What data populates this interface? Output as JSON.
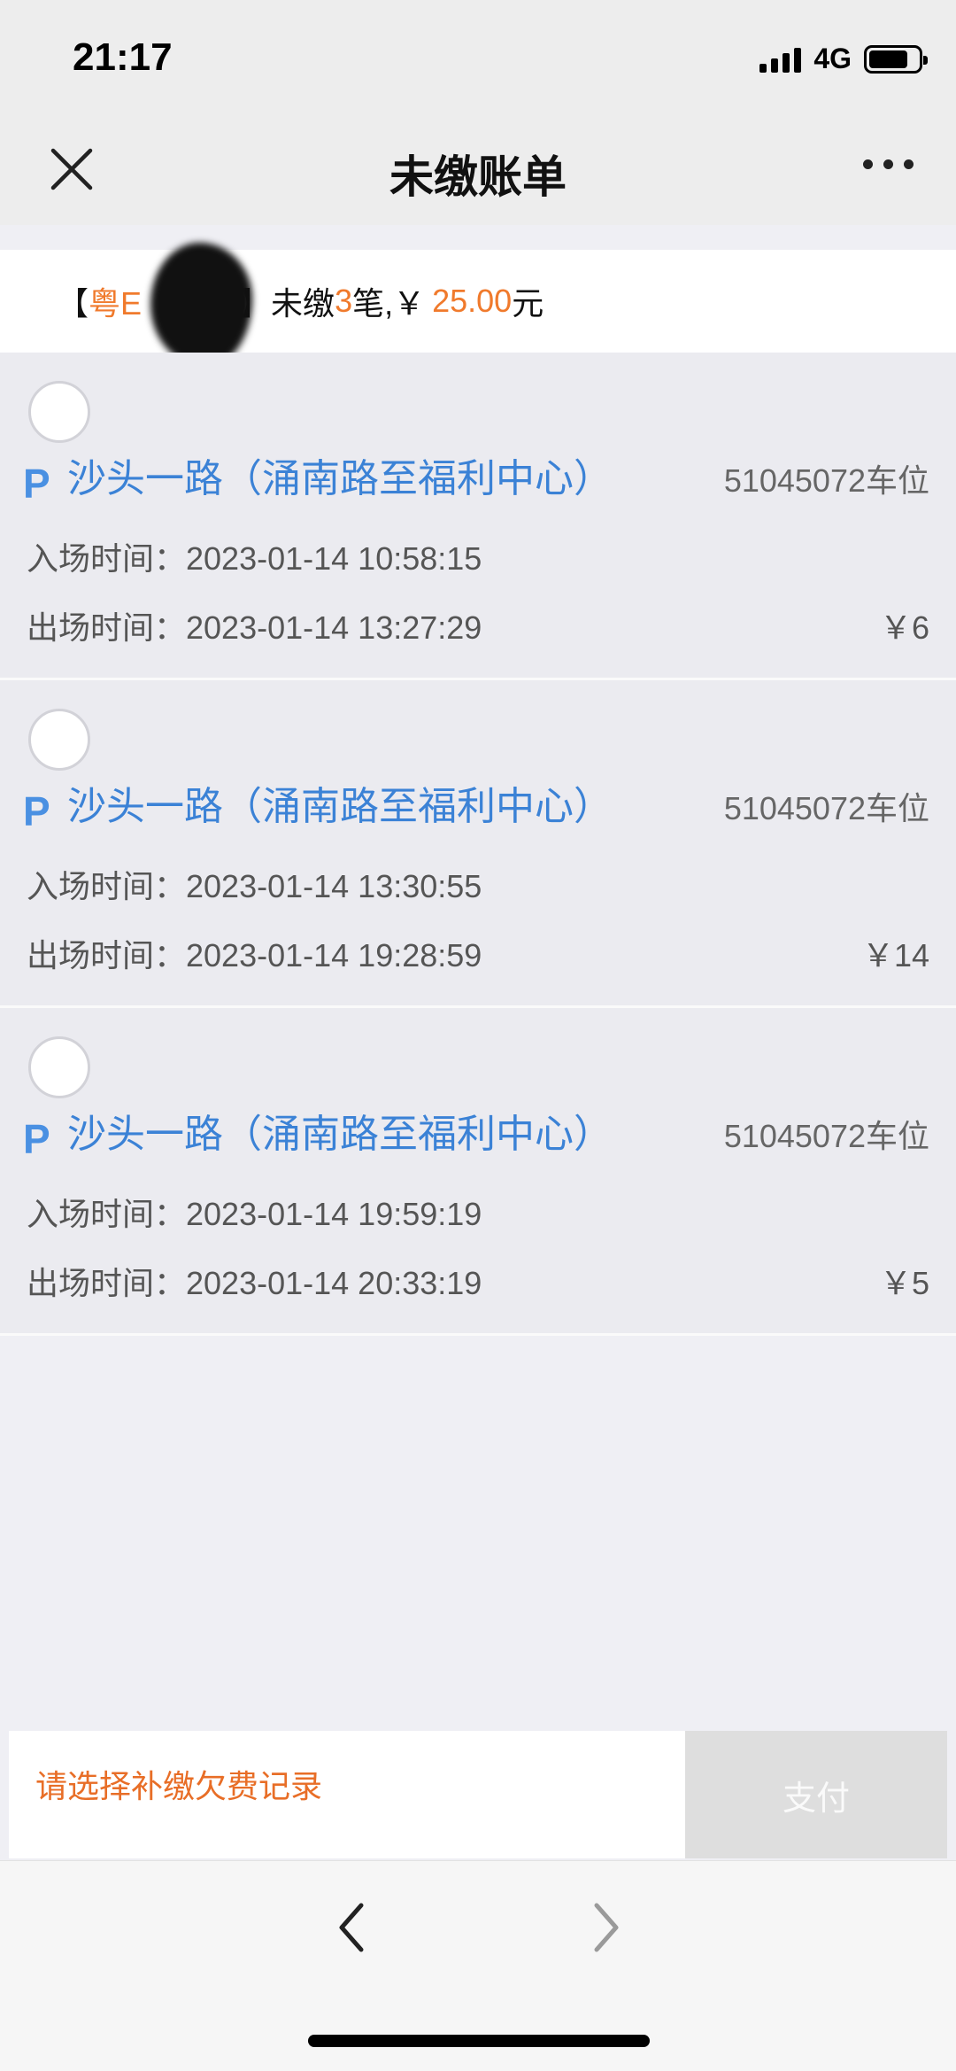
{
  "status_bar": {
    "time": "21:17",
    "network": "4G"
  },
  "nav": {
    "title": "未缴账单"
  },
  "summary": {
    "bracket_open": "【",
    "plate": "粤E",
    "bracket_close": "】",
    "text_unpaid": "未缴",
    "count": "3",
    "text_bills": "笔,￥",
    "amount": "25.00",
    "unit": "元"
  },
  "records": [
    {
      "p": "P",
      "location": "沙头一路（涌南路至福利中心）",
      "spot": "51045072车位",
      "entry_label": "入场时间：",
      "entry_time": "2023-01-14 10:58:15",
      "exit_label": "出场时间：",
      "exit_time": "2023-01-14 13:27:29",
      "price": "￥6"
    },
    {
      "p": "P",
      "location": "沙头一路（涌南路至福利中心）",
      "spot": "51045072车位",
      "entry_label": "入场时间：",
      "entry_time": "2023-01-14 13:30:55",
      "exit_label": "出场时间：",
      "exit_time": "2023-01-14 19:28:59",
      "price": "￥14"
    },
    {
      "p": "P",
      "location": "沙头一路（涌南路至福利中心）",
      "spot": "51045072车位",
      "entry_label": "入场时间：",
      "entry_time": "2023-01-14 19:59:19",
      "exit_label": "出场时间：",
      "exit_time": "2023-01-14 20:33:19",
      "price": "￥5"
    }
  ],
  "action": {
    "hint": "请选择补缴欠费记录",
    "pay_label": "支付"
  },
  "colors": {
    "accent_orange": "#f07a2c",
    "link_blue": "#3b82d6"
  }
}
